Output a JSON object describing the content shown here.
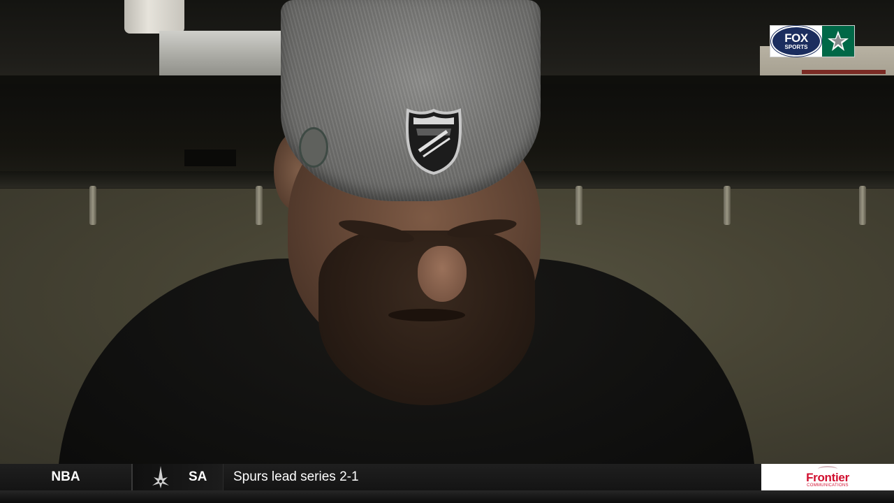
{
  "overlay": {
    "network_logo": {
      "fox_word": "FOX",
      "sports_word": "SPORTS",
      "icon": "fox-sports-logo",
      "team_icon": "dallas-stars-logo",
      "team_color": "#006847",
      "brand_color": "#1b2d5e"
    }
  },
  "ticker": {
    "league": "NBA",
    "team_icon": "san-antonio-spurs-logo",
    "team": "SA",
    "headline": "Spurs lead series 2-1",
    "sponsor": {
      "name": "Frontier",
      "tagline": "COMMUNICATIONS",
      "color": "#d10f2f"
    }
  },
  "scene": {
    "description_icon": "nhl-shield-icon"
  }
}
